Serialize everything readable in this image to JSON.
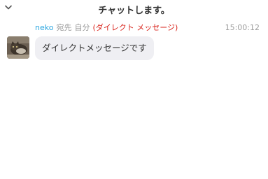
{
  "header": {
    "title": "チャットします。",
    "collapse_icon": "chevron-down-icon"
  },
  "message": {
    "sender": "neko",
    "to_label": "宛先",
    "recipient": "自分",
    "dm_tag": "(ダイレクト メッセージ)",
    "time": "15:00:12",
    "text": "ダイレクトメッセージです"
  },
  "colors": {
    "sender": "#2ea7e0",
    "dm_tag": "#d9251d",
    "muted": "#999999",
    "bubble_bg": "#efeff3"
  }
}
